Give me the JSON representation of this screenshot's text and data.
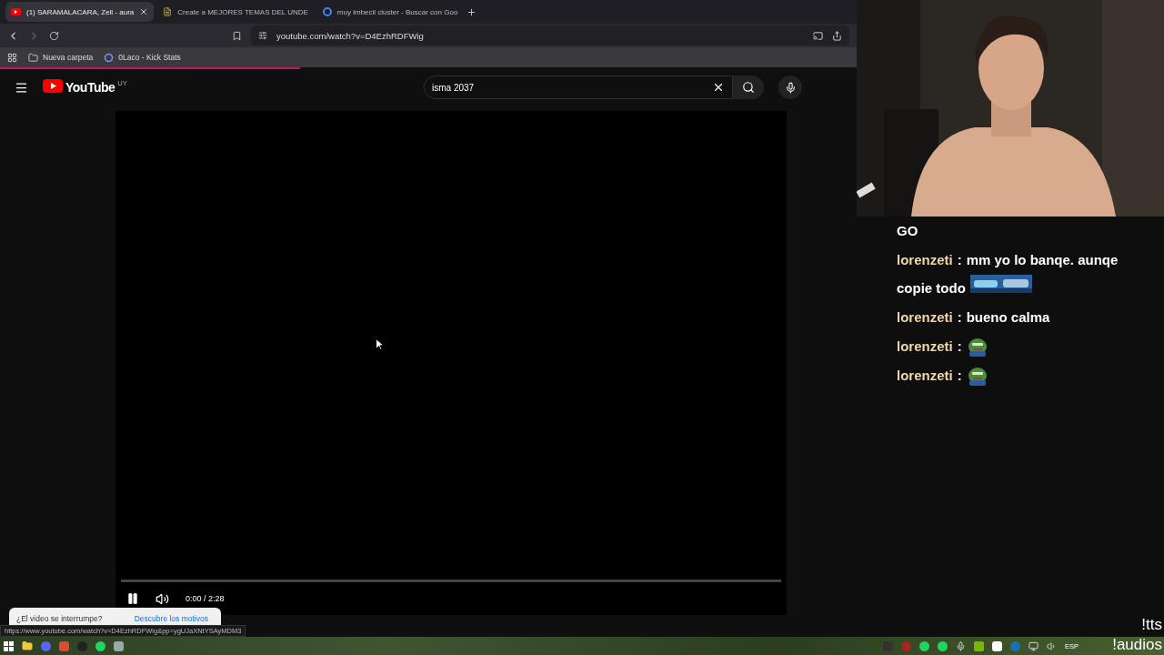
{
  "browser": {
    "tabs": [
      {
        "label": "(1) SARAMALACARA, Zell - aura",
        "kind": "video",
        "selected": true
      },
      {
        "label": "Create a MEJORES TEMAS DEL UNDE",
        "kind": "doc",
        "selected": false
      },
      {
        "label": "muy imbecil cluster - Buscar con Goo",
        "kind": "search",
        "selected": false
      }
    ],
    "address": "youtube.com/watch?v=D4EzhRDFWig",
    "bookmarks": [
      {
        "label": "Nueva carpeta",
        "kind": "folder"
      },
      {
        "label": "0Laco - Kick Stats",
        "kind": "site"
      }
    ],
    "loading": {
      "level": 0.35
    },
    "status_url": "https://www.youtube.com/watch?v=D4EzhRDFWig&pp=ygUJaXNtYSAyMDM3"
  },
  "youtube": {
    "logo": "YouTube",
    "region": "UY",
    "search": {
      "value": "isma 2037"
    },
    "player": {
      "playing": true,
      "time": "0:00 / 2:28"
    },
    "notice": {
      "text": "¿El video se interrumpe?",
      "link": "Descubre los motivos"
    }
  },
  "chat": [
    {
      "kind": "text",
      "text": "GO"
    },
    {
      "kind": "banner",
      "user": "lorenzeti",
      "separator": ":",
      "text": "mm yo lo banqe. aunqe",
      "wrap": "copie todo"
    },
    {
      "kind": "text",
      "user": "lorenzeti",
      "separator": ":",
      "text": "bueno calma"
    },
    {
      "kind": "frog",
      "user": "lorenzeti",
      "separator": ":"
    },
    {
      "kind": "frog",
      "user": "lorenzeti",
      "separator": ":"
    }
  ],
  "overlay": [
    "!tts",
    "!audios"
  ],
  "taskbar": {
    "language": "ESP"
  }
}
